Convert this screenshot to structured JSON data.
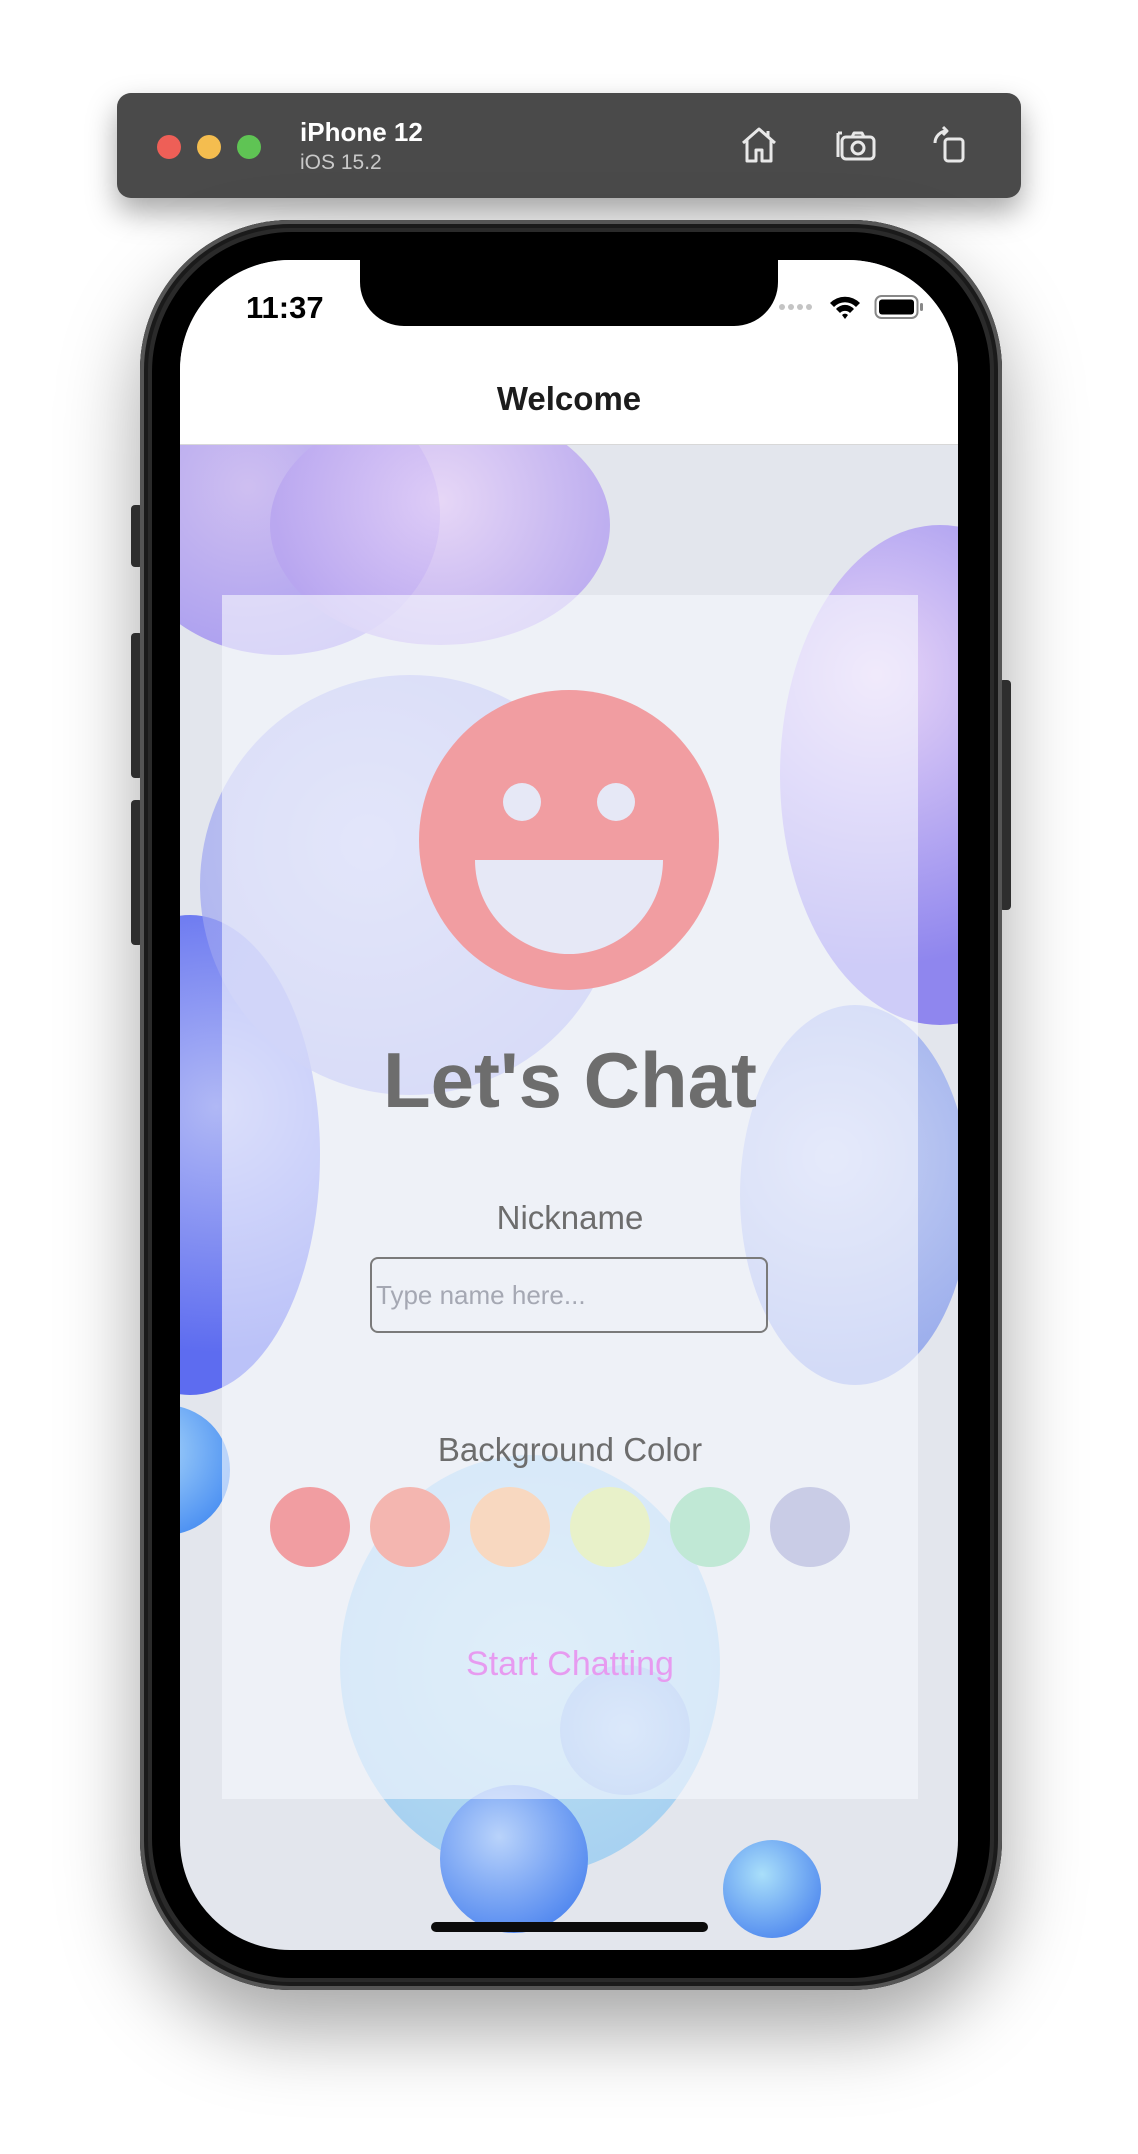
{
  "simulator": {
    "device_name": "iPhone 12",
    "os_version": "iOS 15.2",
    "toolbar_icons": [
      "home-icon",
      "screenshot-icon",
      "rotate-icon"
    ]
  },
  "status_bar": {
    "time": "11:37",
    "icons": [
      "cellular-icon",
      "wifi-icon",
      "battery-icon"
    ]
  },
  "nav": {
    "title": "Welcome"
  },
  "card": {
    "icon": "smiley-icon",
    "title": "Let's Chat",
    "nickname_label": "Nickname",
    "nickname_placeholder": "Type name here...",
    "nickname_value": "",
    "background_label": "Background Color",
    "colors": [
      "#f19da1",
      "#f4b6b0",
      "#f8d8c0",
      "#e8f1c9",
      "#c0e8d5",
      "#c9cce6"
    ],
    "start_button": "Start Chatting"
  },
  "theme": {
    "accent_smiley": "#f19da1",
    "title_gray": "#6d6d6d",
    "button_pink": "#e79bf0"
  }
}
